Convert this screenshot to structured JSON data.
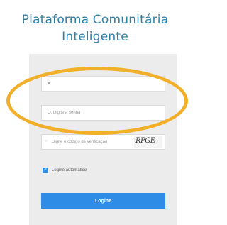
{
  "header": {
    "title_line1": "Plataforma Comunitária",
    "title_line2": "Inteligente"
  },
  "login": {
    "username_value": "A",
    "password_placeholder": "O. Digite a senha",
    "captcha_placeholder": "Digite o código de verificação",
    "captcha_text": "RPGE",
    "auto_login_label": "Logine automatico",
    "login_button_label": "Logine"
  },
  "colors": {
    "title": "#2f7fa6",
    "button": "#2f8ce6",
    "highlight_ring": "#f2b02a",
    "panel": "#ececec"
  }
}
